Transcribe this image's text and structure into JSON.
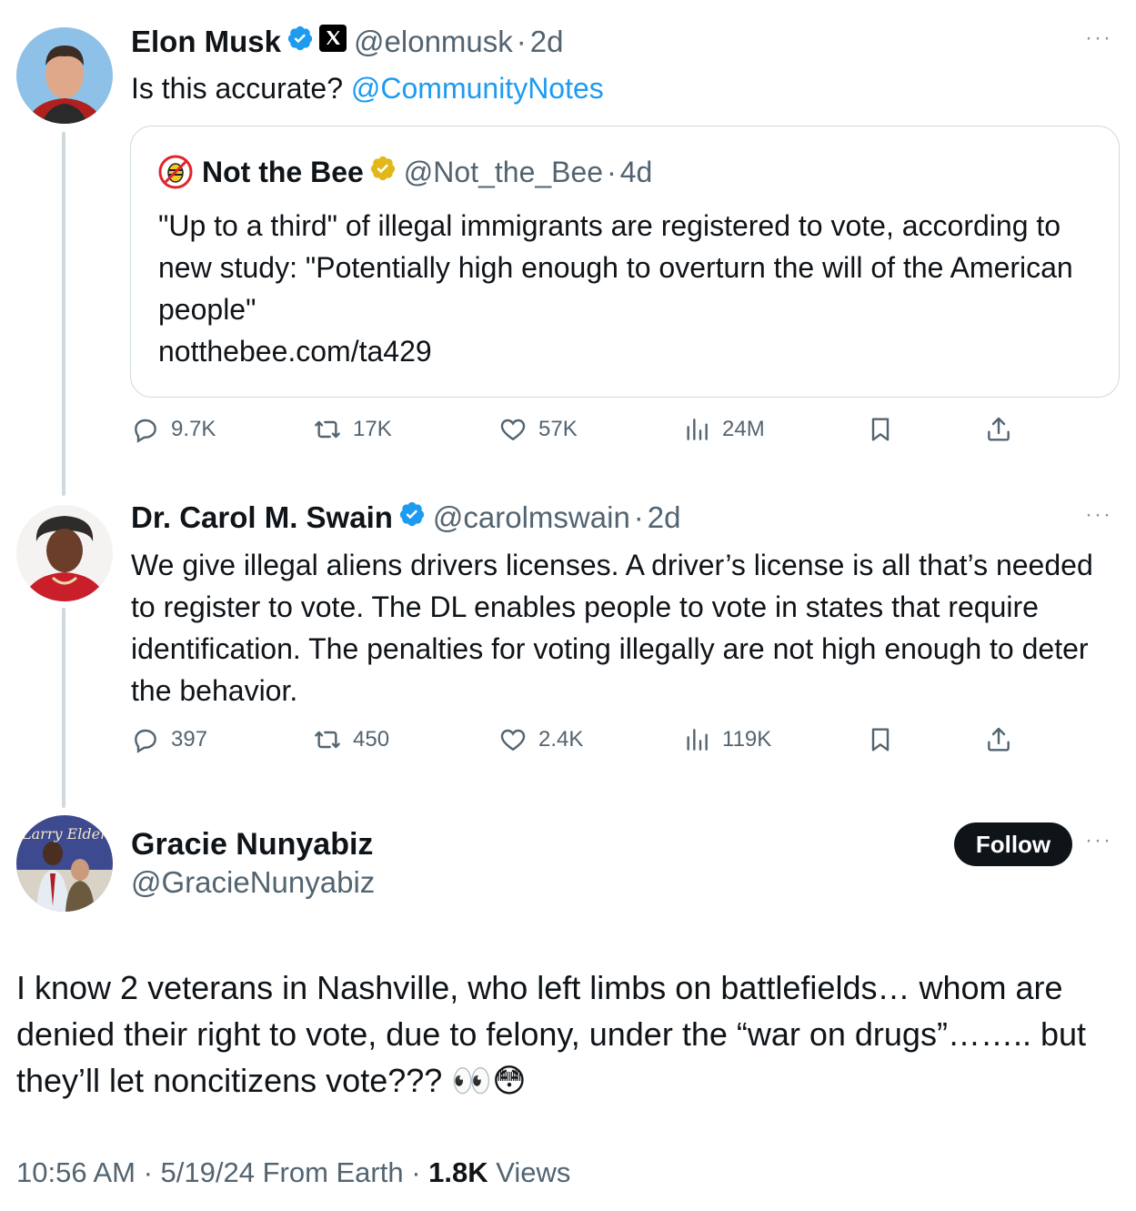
{
  "tweet1": {
    "name": "Elon Musk",
    "handle": "@elonmusk",
    "time": "2d",
    "text_prefix": "Is this accurate? ",
    "mention": "@CommunityNotes",
    "quote": {
      "name": "Not the Bee",
      "handle": "@Not_the_Bee",
      "time": "4d",
      "text": "\"Up to a third\" of illegal immigrants are registered to vote, according to new study: \"Potentially high enough to overturn the will of the American people\"",
      "link": "notthebee.com/ta429"
    },
    "stats": {
      "replies": "9.7K",
      "reposts": "17K",
      "likes": "57K",
      "views": "24M"
    }
  },
  "tweet2": {
    "name": "Dr. Carol M. Swain",
    "handle": "@carolmswain",
    "time": "2d",
    "text": "We give illegal aliens drivers licenses. A driver’s license is all that’s needed to register to vote. The DL enables people to vote in states that require identification.  The penalties for voting illegally are not high enough to deter the behavior.",
    "stats": {
      "replies": "397",
      "reposts": "450",
      "likes": "2.4K",
      "views": "119K"
    }
  },
  "main_tweet": {
    "name": "Gracie Nunyabiz",
    "handle": "@GracieNunyabiz",
    "follow_label": "Follow",
    "text": "I know 2 veterans in Nashville, who left limbs on battlefields… whom are denied their right to vote, due to felony, under the “war on drugs”…….. but they’ll let noncitizens vote??? 👀😳",
    "timestamp": "10:56 AM · 5/19/24 From Earth · ",
    "views_count": "1.8K",
    "views_label": " Views"
  },
  "separator": "·",
  "more_glyph": "···",
  "colors": {
    "accent": "#1d9bf0",
    "gold_badge": "#e2b719",
    "muted": "#536471",
    "border": "#cfd9de"
  }
}
